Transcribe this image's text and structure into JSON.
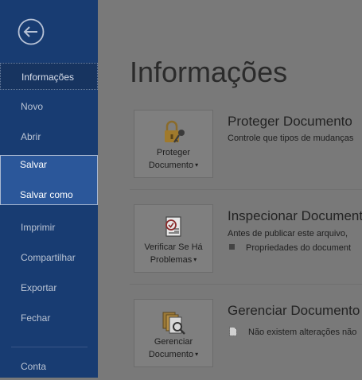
{
  "sidebar": {
    "items": [
      {
        "label": "Informações"
      },
      {
        "label": "Novo"
      },
      {
        "label": "Abrir"
      },
      {
        "label": "Salvar"
      },
      {
        "label": "Salvar como"
      },
      {
        "label": "Imprimir"
      },
      {
        "label": "Compartilhar"
      },
      {
        "label": "Exportar"
      },
      {
        "label": "Fechar"
      },
      {
        "label": "Conta"
      }
    ]
  },
  "main": {
    "title": "Informações",
    "sections": [
      {
        "tile_line1": "Proteger",
        "tile_line2": "Documento",
        "title": "Proteger Documento",
        "desc": "Controle que tipos de mudanças"
      },
      {
        "tile_line1": "Verificar Se Há",
        "tile_line2": "Problemas",
        "title": "Inspecionar Documento",
        "desc": "Antes de publicar este arquivo,",
        "bullet": "Propriedades do document"
      },
      {
        "tile_line1": "Gerenciar",
        "tile_line2": "Documento",
        "title": "Gerenciar Documento",
        "bullet": "Não existem alterações não"
      }
    ]
  },
  "icons": {
    "back": "back-arrow-icon",
    "protect": "lock-key-icon",
    "inspect": "checklist-inspect-icon",
    "manage": "document-magnifier-icon"
  },
  "colors": {
    "sidebar": "#183c72",
    "sidebar_selected": "#2b579a",
    "backdrop": "#797979"
  }
}
